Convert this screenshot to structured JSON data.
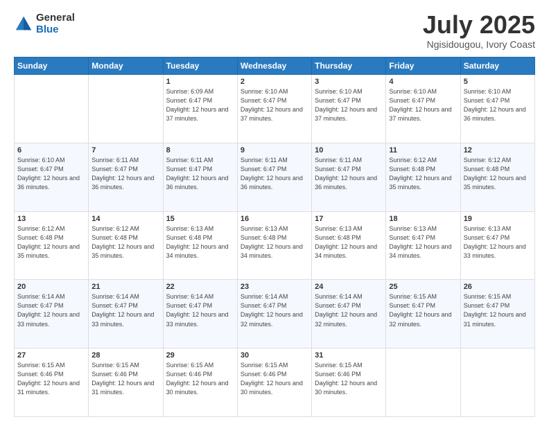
{
  "logo": {
    "general": "General",
    "blue": "Blue"
  },
  "title": {
    "month_year": "July 2025",
    "location": "Ngisidougou, Ivory Coast"
  },
  "weekdays": [
    "Sunday",
    "Monday",
    "Tuesday",
    "Wednesday",
    "Thursday",
    "Friday",
    "Saturday"
  ],
  "weeks": [
    [
      {
        "day": "",
        "sunrise": "",
        "sunset": "",
        "daylight": ""
      },
      {
        "day": "",
        "sunrise": "",
        "sunset": "",
        "daylight": ""
      },
      {
        "day": "1",
        "sunrise": "Sunrise: 6:09 AM",
        "sunset": "Sunset: 6:47 PM",
        "daylight": "Daylight: 12 hours and 37 minutes."
      },
      {
        "day": "2",
        "sunrise": "Sunrise: 6:10 AM",
        "sunset": "Sunset: 6:47 PM",
        "daylight": "Daylight: 12 hours and 37 minutes."
      },
      {
        "day": "3",
        "sunrise": "Sunrise: 6:10 AM",
        "sunset": "Sunset: 6:47 PM",
        "daylight": "Daylight: 12 hours and 37 minutes."
      },
      {
        "day": "4",
        "sunrise": "Sunrise: 6:10 AM",
        "sunset": "Sunset: 6:47 PM",
        "daylight": "Daylight: 12 hours and 37 minutes."
      },
      {
        "day": "5",
        "sunrise": "Sunrise: 6:10 AM",
        "sunset": "Sunset: 6:47 PM",
        "daylight": "Daylight: 12 hours and 36 minutes."
      }
    ],
    [
      {
        "day": "6",
        "sunrise": "Sunrise: 6:10 AM",
        "sunset": "Sunset: 6:47 PM",
        "daylight": "Daylight: 12 hours and 36 minutes."
      },
      {
        "day": "7",
        "sunrise": "Sunrise: 6:11 AM",
        "sunset": "Sunset: 6:47 PM",
        "daylight": "Daylight: 12 hours and 36 minutes."
      },
      {
        "day": "8",
        "sunrise": "Sunrise: 6:11 AM",
        "sunset": "Sunset: 6:47 PM",
        "daylight": "Daylight: 12 hours and 36 minutes."
      },
      {
        "day": "9",
        "sunrise": "Sunrise: 6:11 AM",
        "sunset": "Sunset: 6:47 PM",
        "daylight": "Daylight: 12 hours and 36 minutes."
      },
      {
        "day": "10",
        "sunrise": "Sunrise: 6:11 AM",
        "sunset": "Sunset: 6:47 PM",
        "daylight": "Daylight: 12 hours and 36 minutes."
      },
      {
        "day": "11",
        "sunrise": "Sunrise: 6:12 AM",
        "sunset": "Sunset: 6:48 PM",
        "daylight": "Daylight: 12 hours and 35 minutes."
      },
      {
        "day": "12",
        "sunrise": "Sunrise: 6:12 AM",
        "sunset": "Sunset: 6:48 PM",
        "daylight": "Daylight: 12 hours and 35 minutes."
      }
    ],
    [
      {
        "day": "13",
        "sunrise": "Sunrise: 6:12 AM",
        "sunset": "Sunset: 6:48 PM",
        "daylight": "Daylight: 12 hours and 35 minutes."
      },
      {
        "day": "14",
        "sunrise": "Sunrise: 6:12 AM",
        "sunset": "Sunset: 6:48 PM",
        "daylight": "Daylight: 12 hours and 35 minutes."
      },
      {
        "day": "15",
        "sunrise": "Sunrise: 6:13 AM",
        "sunset": "Sunset: 6:48 PM",
        "daylight": "Daylight: 12 hours and 34 minutes."
      },
      {
        "day": "16",
        "sunrise": "Sunrise: 6:13 AM",
        "sunset": "Sunset: 6:48 PM",
        "daylight": "Daylight: 12 hours and 34 minutes."
      },
      {
        "day": "17",
        "sunrise": "Sunrise: 6:13 AM",
        "sunset": "Sunset: 6:48 PM",
        "daylight": "Daylight: 12 hours and 34 minutes."
      },
      {
        "day": "18",
        "sunrise": "Sunrise: 6:13 AM",
        "sunset": "Sunset: 6:47 PM",
        "daylight": "Daylight: 12 hours and 34 minutes."
      },
      {
        "day": "19",
        "sunrise": "Sunrise: 6:13 AM",
        "sunset": "Sunset: 6:47 PM",
        "daylight": "Daylight: 12 hours and 33 minutes."
      }
    ],
    [
      {
        "day": "20",
        "sunrise": "Sunrise: 6:14 AM",
        "sunset": "Sunset: 6:47 PM",
        "daylight": "Daylight: 12 hours and 33 minutes."
      },
      {
        "day": "21",
        "sunrise": "Sunrise: 6:14 AM",
        "sunset": "Sunset: 6:47 PM",
        "daylight": "Daylight: 12 hours and 33 minutes."
      },
      {
        "day": "22",
        "sunrise": "Sunrise: 6:14 AM",
        "sunset": "Sunset: 6:47 PM",
        "daylight": "Daylight: 12 hours and 33 minutes."
      },
      {
        "day": "23",
        "sunrise": "Sunrise: 6:14 AM",
        "sunset": "Sunset: 6:47 PM",
        "daylight": "Daylight: 12 hours and 32 minutes."
      },
      {
        "day": "24",
        "sunrise": "Sunrise: 6:14 AM",
        "sunset": "Sunset: 6:47 PM",
        "daylight": "Daylight: 12 hours and 32 minutes."
      },
      {
        "day": "25",
        "sunrise": "Sunrise: 6:15 AM",
        "sunset": "Sunset: 6:47 PM",
        "daylight": "Daylight: 12 hours and 32 minutes."
      },
      {
        "day": "26",
        "sunrise": "Sunrise: 6:15 AM",
        "sunset": "Sunset: 6:47 PM",
        "daylight": "Daylight: 12 hours and 31 minutes."
      }
    ],
    [
      {
        "day": "27",
        "sunrise": "Sunrise: 6:15 AM",
        "sunset": "Sunset: 6:46 PM",
        "daylight": "Daylight: 12 hours and 31 minutes."
      },
      {
        "day": "28",
        "sunrise": "Sunrise: 6:15 AM",
        "sunset": "Sunset: 6:46 PM",
        "daylight": "Daylight: 12 hours and 31 minutes."
      },
      {
        "day": "29",
        "sunrise": "Sunrise: 6:15 AM",
        "sunset": "Sunset: 6:46 PM",
        "daylight": "Daylight: 12 hours and 30 minutes."
      },
      {
        "day": "30",
        "sunrise": "Sunrise: 6:15 AM",
        "sunset": "Sunset: 6:46 PM",
        "daylight": "Daylight: 12 hours and 30 minutes."
      },
      {
        "day": "31",
        "sunrise": "Sunrise: 6:15 AM",
        "sunset": "Sunset: 6:46 PM",
        "daylight": "Daylight: 12 hours and 30 minutes."
      },
      {
        "day": "",
        "sunrise": "",
        "sunset": "",
        "daylight": ""
      },
      {
        "day": "",
        "sunrise": "",
        "sunset": "",
        "daylight": ""
      }
    ]
  ]
}
